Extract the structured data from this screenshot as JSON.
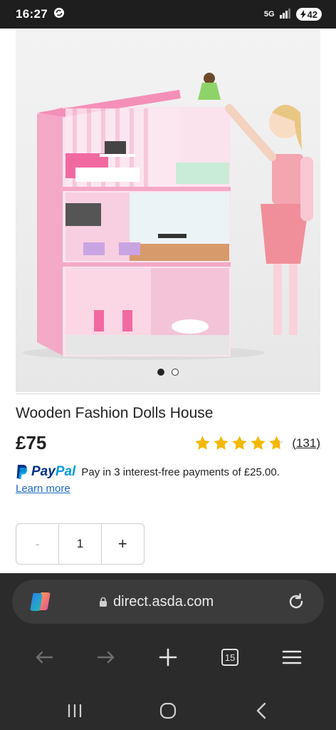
{
  "status": {
    "time": "16:27",
    "network": "5G",
    "battery": "42"
  },
  "product": {
    "title": "Wooden Fashion Dolls House",
    "price": "£75",
    "rating_value": 4.5,
    "rating_count": "(131)",
    "carousel_active": 1,
    "carousel_total": 2
  },
  "paypal": {
    "brand_a": "Pay",
    "brand_b": "Pal",
    "text": "Pay in 3 interest-free payments of £25.00.",
    "learn_more": "Learn more"
  },
  "quantity": {
    "minus": "-",
    "value": "1",
    "plus": "+"
  },
  "browser": {
    "url": "direct.asda.com",
    "tab_count": "15"
  },
  "colors": {
    "star": "#f5b800",
    "paypal_dark": "#003087",
    "paypal_light": "#009cde",
    "link": "#1a6bc4",
    "browser_bg": "#2b2b2b"
  }
}
